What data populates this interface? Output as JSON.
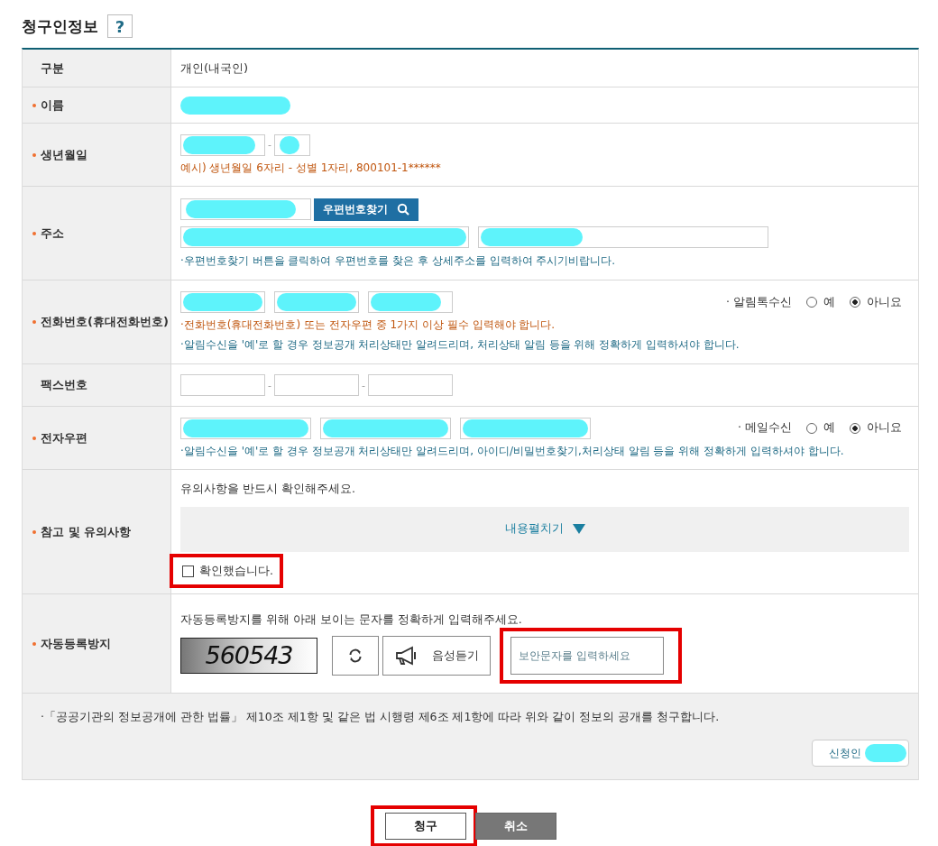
{
  "section_title": "청구인정보",
  "help_button": "?",
  "rows": [
    {
      "kind": "plain",
      "label": "구분",
      "required": false,
      "value": "개인(내국인)"
    },
    {
      "kind": "input",
      "label": "이름",
      "required": true,
      "lines": [
        {
          "redacted": true
        }
      ]
    },
    {
      "kind": "input",
      "label": "생년월일",
      "required": true,
      "lines": [
        {
          "fields": [
            {
              "redacted": true
            },
            {
              "redacted": true
            }
          ],
          "separator": "-"
        }
      ],
      "notes": [
        {
          "text": "예시) 생년월일 6자리 - 성별 1자리, 800101-1******",
          "color": "#c0560f"
        }
      ]
    },
    {
      "kind": "input",
      "label": "주소",
      "required": true,
      "lines": [
        {
          "fields": [
            {
              "redacted": true
            }
          ],
          "button": {
            "label": "우편번호찾기"
          }
        },
        {
          "fields": [
            {
              "redacted": true
            },
            {
              "redacted": true
            }
          ]
        }
      ],
      "notes": [
        {
          "text": "·우편번호찾기 버튼을 클릭하여 우편번호를 찾은 후 상세주소를 입력하여 주시기비랍니다.",
          "color": "#1f6a85"
        }
      ]
    },
    {
      "kind": "input",
      "label": "전화번호(휴대전화번호)",
      "required": true,
      "lines": [
        {
          "fields": [
            {
              "redacted": true
            },
            {
              "redacted": true
            },
            {
              "redacted": true
            }
          ],
          "option": {
            "label": "· 알림톡수신",
            "choices": [
              {
                "label": "예",
                "selected": false
              },
              {
                "label": "아니요",
                "selected": true
              }
            ]
          }
        }
      ],
      "notes": [
        {
          "text": "·전화번호(휴대전화번호) 또는 전자우편 중 1가지 이상 필수 입력해야 합니다.",
          "color": "#c0560f"
        },
        {
          "text": "·알림수신을 '예'로 할 경우 정보공개 처리상태만 알려드리며, 처리상태 알림 등을 위해 정확하게 입력하셔야 합니다.",
          "color": "#1f6a85"
        }
      ]
    },
    {
      "kind": "input",
      "label": "팩스번호",
      "required": false,
      "lines": [
        {
          "fields": [
            {
              "redacted": false
            },
            {
              "redacted": false
            },
            {
              "redacted": false
            }
          ],
          "separator": "-"
        }
      ]
    },
    {
      "kind": "input",
      "label": "전자우편",
      "required": true,
      "lines": [
        {
          "fields": [
            {
              "redacted": true
            },
            {
              "redacted": true
            },
            {
              "redacted": true
            }
          ],
          "option": {
            "label": "· 메일수신",
            "choices": [
              {
                "label": "예",
                "selected": false
              },
              {
                "label": "아니요",
                "selected": true
              }
            ]
          }
        }
      ],
      "notes": [
        {
          "text": "·알림수신을 '예'로 할 경우 정보공개 처리상태만 알려드리며, 아이디/비밀번호찾기,처리상태 알림 등을 위해 정확하게 입력하셔야 합니다.",
          "color": "#1f6a85"
        }
      ]
    },
    {
      "kind": "consent",
      "label": "참고 및 유의사항",
      "required": true,
      "intro": "유의사항을 반드시 확인해주세요.",
      "expander": {
        "label": "내용펼치기",
        "expanded": false
      },
      "checkbox": {
        "label": "확인했습니다.",
        "checked": false,
        "highlighted": true
      }
    },
    {
      "kind": "captcha",
      "label": "자동등록방지",
      "required": true,
      "intro": "자동등록방지를 위해 아래 보이는 문자를 정확하게 입력해주세요.",
      "captcha_text": "560543",
      "audio_button": "음성듣기",
      "input": {
        "placeholder": "보안문자를 입력하세요",
        "highlighted": true
      }
    }
  ],
  "footer": {
    "statement": "·「공공기관의 정보공개에 관한 법률」 제10조 제1항 및 같은 법 시행령 제6조 제1항에 따라 위와 같이 정보의 공개를 청구합니다.",
    "applicant": {
      "label": "신청인",
      "redacted": true
    }
  },
  "buttons": [
    {
      "label": "청구",
      "kind": "primary",
      "highlighted": true
    },
    {
      "label": "취소",
      "kind": "secondary",
      "highlighted": false
    }
  ]
}
